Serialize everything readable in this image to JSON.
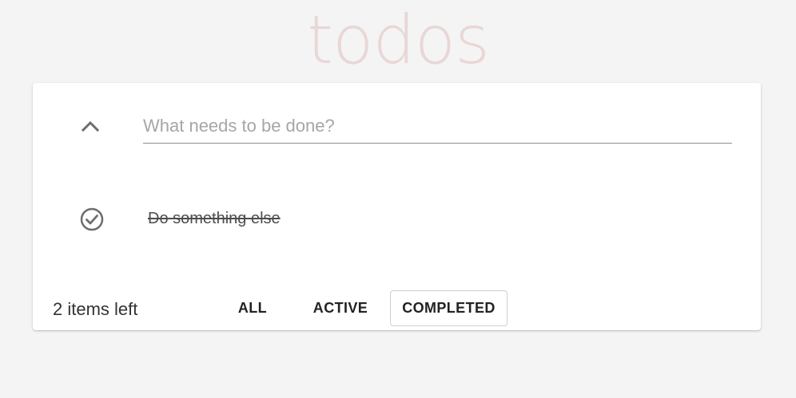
{
  "header": {
    "title": "todos"
  },
  "new_todo": {
    "placeholder": "What needs to be done?",
    "value": ""
  },
  "toggle_all": {
    "icon": "chevron-up-icon"
  },
  "todos": [
    {
      "label": "Do something else",
      "completed": true,
      "icon": "check-circle-icon"
    }
  ],
  "footer": {
    "count_text": "2 items left",
    "filters": [
      {
        "label": "ALL",
        "selected": false
      },
      {
        "label": "ACTIVE",
        "selected": false
      },
      {
        "label": "COMPLETED",
        "selected": true
      }
    ]
  },
  "colors": {
    "title": "#efdada",
    "background": "#f4f4f4",
    "card": "#ffffff",
    "icon": "#6e6e6e",
    "selected_border": "#cfcfcf"
  }
}
